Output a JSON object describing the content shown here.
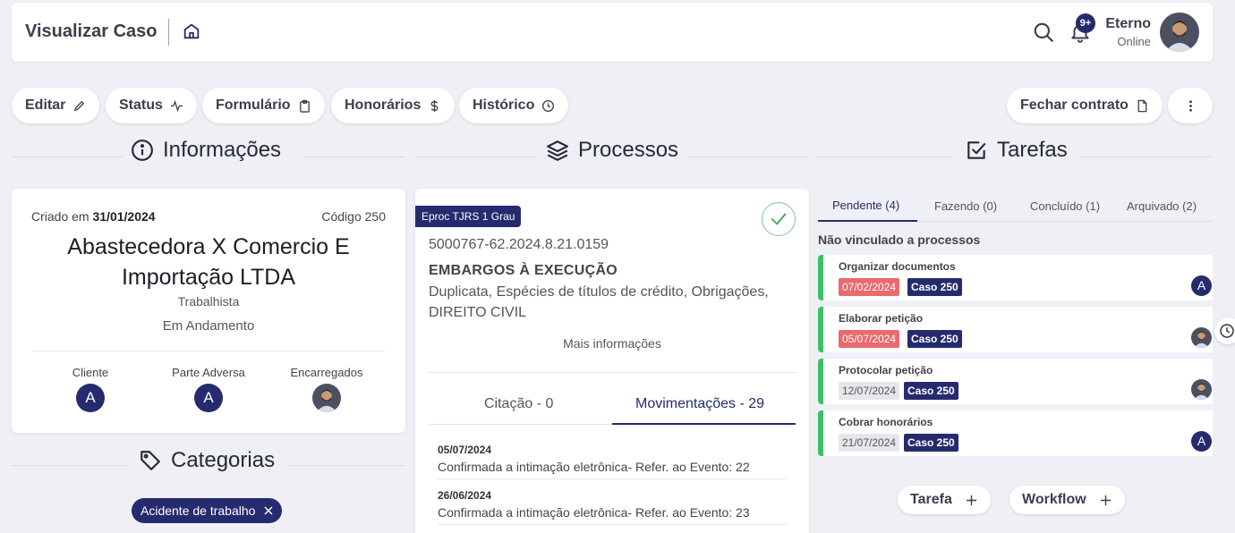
{
  "header": {
    "title": "Visualizar Caso",
    "notifications_badge": "9+",
    "user_name": "Eterno",
    "user_status": "Online"
  },
  "toolbar": {
    "edit": "Editar",
    "status": "Status",
    "form": "Formulário",
    "fees": "Honorários",
    "history": "Histórico",
    "close_contract": "Fechar contrato"
  },
  "sections": {
    "info": "Informações",
    "processes": "Processos",
    "tasks": "Tarefas",
    "categories": "Categorias"
  },
  "info": {
    "created_label": "Criado em",
    "created_date": "31/01/2024",
    "code": "Código 250",
    "title": "Abastecedora X Comercio E Importação LTDA",
    "area": "Trabalhista",
    "status": "Em Andamento",
    "client_label": "Cliente",
    "client_initial": "A",
    "adverse_label": "Parte Adversa",
    "adverse_initial": "A",
    "managers_label": "Encarregados"
  },
  "categories": [
    {
      "label": "Acidente de trabalho"
    }
  ],
  "process": {
    "badge": "Eproc TJRS 1 Grau",
    "number": "5000767-62.2024.8.21.0159",
    "type": "EMBARGOS À EXECUÇÃO",
    "description": "Duplicata, Espécies de títulos de crédito, Obrigações, DIREITO CIVIL",
    "more_info": "Mais informações",
    "tab_citations": "Citação - 0",
    "tab_movements": "Movimentações - 29",
    "movements": [
      {
        "date": "05/07/2024",
        "text": "Confirmada a intimação eletrônica- Refer. ao Evento: 22"
      },
      {
        "date": "26/06/2024",
        "text": "Confirmada a intimação eletrônica- Refer. ao Evento: 23"
      }
    ]
  },
  "tasks": {
    "tabs": [
      "Pendente (4)",
      "Fazendo (0)",
      "Concluído (1)",
      "Arquivado (2)"
    ],
    "unlinked_label": "Não vinculado a processos",
    "items": [
      {
        "title": "Organizar documentos",
        "date": "07/02/2024",
        "case": "Caso 250",
        "avatar": "A"
      },
      {
        "title": "Elaborar petição",
        "date": "05/07/2024",
        "case": "Caso 250",
        "avatar": ""
      },
      {
        "title": "Protocolar petição",
        "date": "12/07/2024",
        "case": "Caso 250",
        "avatar": ""
      },
      {
        "title": "Cobrar honorários",
        "date": "21/07/2024",
        "case": "Caso 250",
        "avatar": "A"
      }
    ],
    "add_task": "Tarefa",
    "add_workflow": "Workflow"
  },
  "colors": {
    "brand": "#262b6f",
    "overdue": "#ea6a6f",
    "task_accent": "#3fbf6a",
    "check": "#3fa866"
  }
}
